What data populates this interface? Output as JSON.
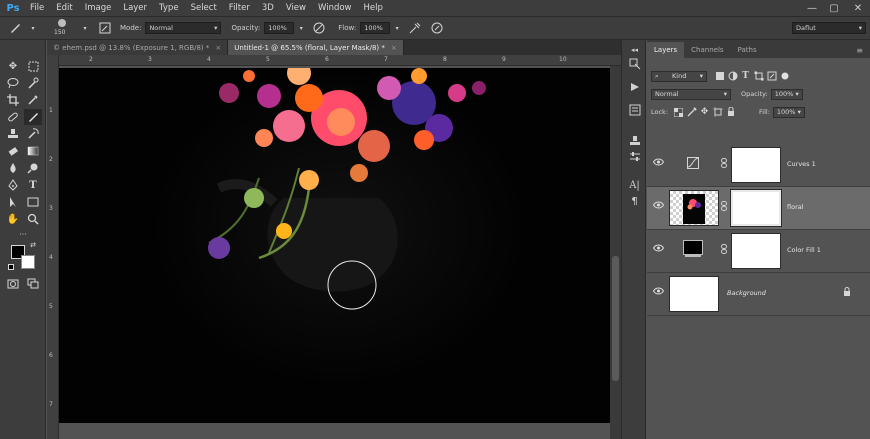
{
  "app": {
    "logo": "Ps"
  },
  "menu": [
    "File",
    "Edit",
    "Image",
    "Layer",
    "Type",
    "Select",
    "Filter",
    "3D",
    "View",
    "Window",
    "Help"
  ],
  "window_controls": {
    "minimize": "—",
    "maximize": "▢",
    "close": "✕"
  },
  "options": {
    "brush_size": "150",
    "mode_label": "Mode:",
    "mode_value": "Normal",
    "opacity_label": "Opacity:",
    "opacity_value": "100%",
    "flow_label": "Flow:",
    "flow_value": "100%",
    "workspace": "Daflut"
  },
  "tabs": [
    {
      "title": "© ehem.psd @ 13.8% (Exposure 1, RGB/8) *",
      "close": "×",
      "active": false
    },
    {
      "title": "Untitled-1 @ 65.5% (floral, Layer Mask/8) *",
      "close": "×",
      "active": true
    }
  ],
  "rulers": {
    "top": [
      "2",
      "3",
      "4",
      "5",
      "6",
      "7",
      "8",
      "9",
      "10"
    ],
    "left": [
      "1",
      "2",
      "3",
      "4",
      "5",
      "6",
      "7"
    ]
  },
  "layers_panel": {
    "tabs": [
      "Layers",
      "Channels",
      "Paths"
    ],
    "filter_kind": "Kind",
    "blend_mode": "Normal",
    "opacity_label": "Opacity:",
    "opacity_value": "100%",
    "lock_label": "Lock:",
    "fill_label": "Fill:",
    "fill_value": "100%",
    "layers": [
      {
        "name": "Curves 1",
        "italic": false
      },
      {
        "name": "floral",
        "italic": false
      },
      {
        "name": "Color Fill 1",
        "italic": false
      },
      {
        "name": "Background",
        "italic": true
      }
    ]
  },
  "colors": {
    "accent": "#3fa9f5",
    "canvas": "#020202",
    "panel": "#535353",
    "chrome": "#3d3d3d"
  }
}
